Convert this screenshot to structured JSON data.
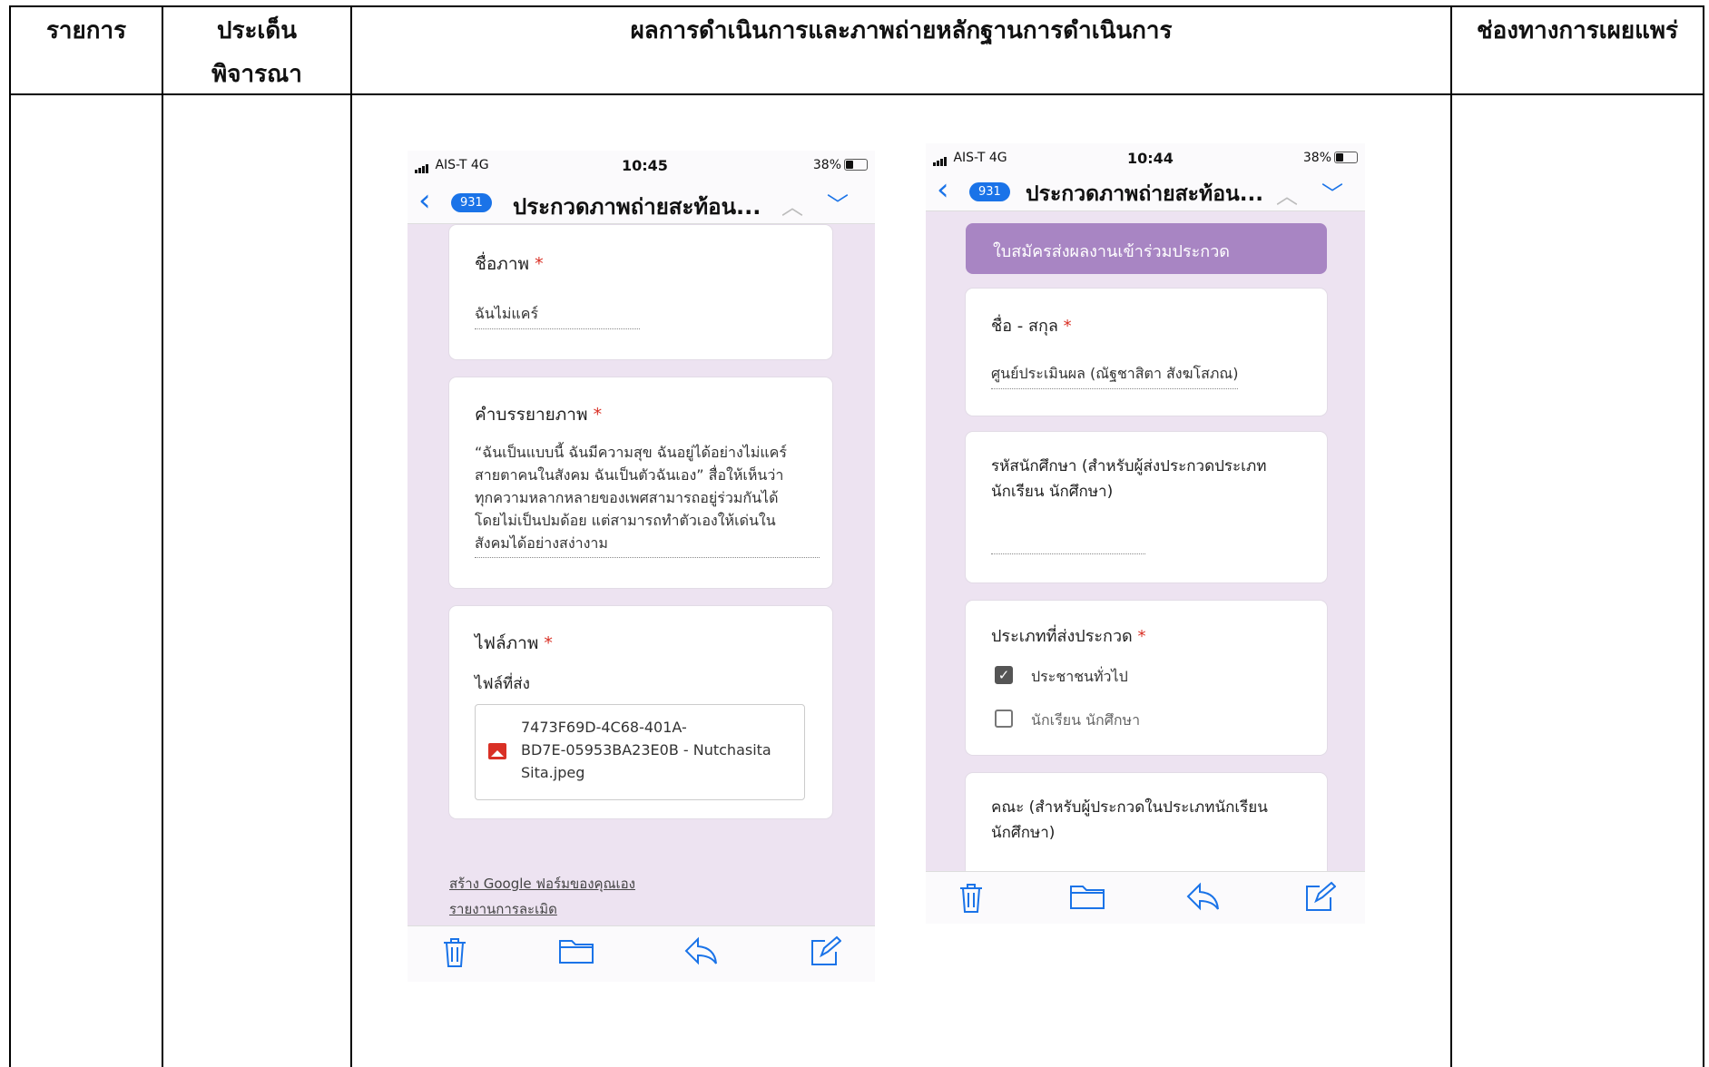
{
  "table": {
    "headers": [
      "รายการ",
      "ประเด็น\nพิจารณา",
      "ผลการดำเนินการและภาพถ่ายหลักฐานการดำเนินการ",
      "ช่องทางการเผยแพร่"
    ]
  },
  "phone_left": {
    "carrier": "AIS-T  4G",
    "time": "10:45",
    "battery": "38%",
    "back_icon": "chevron-left-icon",
    "mail_count": "931",
    "title": "ประกวดภาพถ่ายสะท้อน...",
    "q1_label": "ชื่อภาพ",
    "q1_answer": "ฉันไม่แคร์",
    "q2_label": "คำบรรยายภาพ",
    "q2_answer_lines": [
      "“ฉันเป็นแบบนี้ ฉันมีความสุข ฉันอยู่ได้อย่างไม่แคร์",
      "สายตาคนในสังคม ฉันเป็นตัวฉันเอง” สื่อให้เห็นว่า",
      "ทุกความหลากหลายของเพศสามารถอยู่ร่วมกันได้",
      "โดยไม่เป็นปมด้อย แต่สามารถทำตัวเองให้เด่นใน",
      "สังคมได้อย่างสง่างาม"
    ],
    "q3_label": "ไฟล์ภาพ",
    "q3_sublabel": "ไฟล์ที่ส่ง",
    "file_lines": [
      "7473F69D-4C68-401A-",
      "BD7E-05953BA23E0B - Nutchasita",
      "Sita.jpeg"
    ],
    "link1": "สร้าง Google ฟอร์มของคุณเอง",
    "link2": "รายงานการละเมิด",
    "required_mark": "*"
  },
  "phone_right": {
    "carrier": "AIS-T  4G",
    "time": "10:44",
    "battery": "38%",
    "mail_count": "931",
    "title": "ประกวดภาพถ่ายสะท้อน...",
    "banner": "ใบสมัครส่งผลงานเข้าร่วมประกวด",
    "q1_label": "ชื่อ - สกุล",
    "q1_answer": "ศูนย์ประเมินผล  (ณัฐชาสิตา สังฆโสภณ)",
    "q2_label_lines": [
      "รหัสนักศึกษา (สำหรับผู้ส่งประกวดประเภท",
      "นักเรียน นักศึกษา)"
    ],
    "q3_label": "ประเภทที่ส่งประกวด",
    "options": [
      {
        "label": "ประชาชนทั่วไป",
        "checked": true
      },
      {
        "label": "นักเรียน นักศึกษา",
        "checked": false
      }
    ],
    "q4_label_lines": [
      "คณะ (สำหรับผู้ประกวดในประเภทนักเรียน",
      "นักศึกษา)"
    ],
    "required_mark": "*"
  },
  "colors": {
    "accent": "#1a73e8",
    "form_purple": "#a885c3",
    "form_bg": "#ede3f1",
    "required": "#d93025"
  }
}
